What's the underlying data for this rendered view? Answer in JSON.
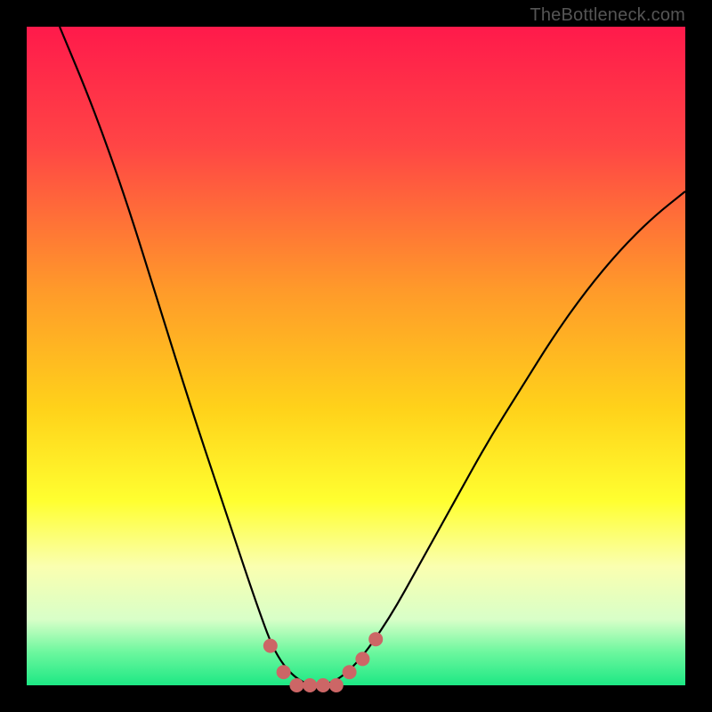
{
  "watermark": "TheBottleneck.com",
  "chart_data": {
    "type": "line",
    "title": "",
    "xlabel": "",
    "ylabel": "",
    "xlim": [
      0,
      100
    ],
    "ylim": [
      0,
      100
    ],
    "grid": false,
    "legend": false,
    "background_gradient_stops": [
      {
        "pct": 0,
        "color": "#ff1a4b"
      },
      {
        "pct": 18,
        "color": "#ff4545"
      },
      {
        "pct": 40,
        "color": "#ff9a2a"
      },
      {
        "pct": 58,
        "color": "#ffd21a"
      },
      {
        "pct": 72,
        "color": "#ffff30"
      },
      {
        "pct": 82,
        "color": "#faffb0"
      },
      {
        "pct": 90,
        "color": "#d8ffc8"
      },
      {
        "pct": 95,
        "color": "#6cf79e"
      },
      {
        "pct": 100,
        "color": "#1de884"
      }
    ],
    "series": [
      {
        "name": "bottleneck-curve",
        "stroke": "#000000",
        "points": [
          {
            "x": 5,
            "y": 100
          },
          {
            "x": 10,
            "y": 88
          },
          {
            "x": 15,
            "y": 74
          },
          {
            "x": 20,
            "y": 58
          },
          {
            "x": 25,
            "y": 42
          },
          {
            "x": 30,
            "y": 27
          },
          {
            "x": 35,
            "y": 12
          },
          {
            "x": 38,
            "y": 4
          },
          {
            "x": 42,
            "y": 0
          },
          {
            "x": 46,
            "y": 0
          },
          {
            "x": 50,
            "y": 3
          },
          {
            "x": 55,
            "y": 10
          },
          {
            "x": 60,
            "y": 19
          },
          {
            "x": 65,
            "y": 28
          },
          {
            "x": 70,
            "y": 37
          },
          {
            "x": 75,
            "y": 45
          },
          {
            "x": 80,
            "y": 53
          },
          {
            "x": 85,
            "y": 60
          },
          {
            "x": 90,
            "y": 66
          },
          {
            "x": 95,
            "y": 71
          },
          {
            "x": 100,
            "y": 75
          }
        ]
      }
    ],
    "markers": {
      "color": "#cc6666",
      "radius_px": 8,
      "points": [
        {
          "x": 37,
          "y": 6
        },
        {
          "x": 39,
          "y": 2
        },
        {
          "x": 41,
          "y": 0
        },
        {
          "x": 43,
          "y": 0
        },
        {
          "x": 45,
          "y": 0
        },
        {
          "x": 47,
          "y": 0
        },
        {
          "x": 49,
          "y": 2
        },
        {
          "x": 51,
          "y": 4
        },
        {
          "x": 53,
          "y": 7
        }
      ]
    }
  }
}
